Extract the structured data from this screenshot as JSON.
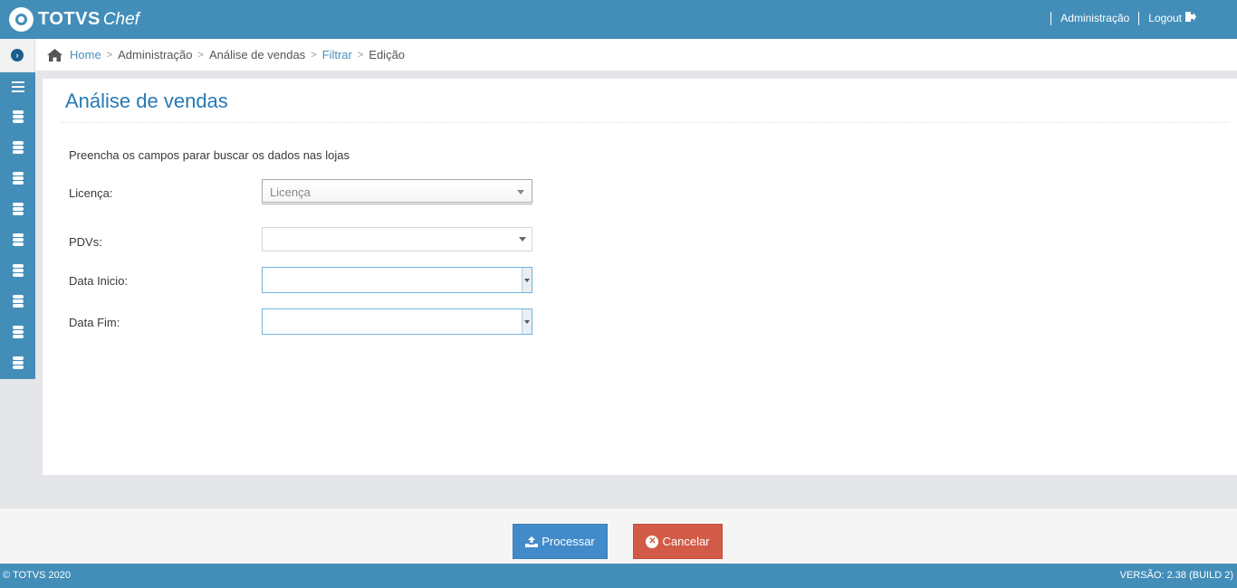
{
  "header": {
    "brand_totvs": "TOTVS",
    "brand_chef": "Chef",
    "admin_link": "Administração",
    "logout_link": "Logout"
  },
  "breadcrumb": {
    "home": "Home",
    "administracao": "Administração",
    "analise": "Análise de vendas",
    "filtrar": "Filtrar",
    "edicao": "Edição"
  },
  "page": {
    "title": "Análise de vendas",
    "instructions": "Preencha os campos parar buscar os dados nas lojas"
  },
  "form": {
    "licenca_label": "Licença:",
    "licenca_value": "Licença",
    "pdvs_label": "PDVs:",
    "pdvs_value": "",
    "data_inicio_label": "Data Inicio:",
    "data_inicio_value": "",
    "data_fim_label": "Data Fim:",
    "data_fim_value": ""
  },
  "actions": {
    "processar": "Processar",
    "cancelar": "Cancelar"
  },
  "footer": {
    "copyright": "© TOTVS 2020",
    "version": "VERSÃO: 2.38 (BUILD 2)"
  },
  "colors": {
    "brand": "#438eb9",
    "primary_button": "#428bca",
    "danger_button": "#d15b47",
    "title": "#2679b5"
  },
  "icons": {
    "sidebar_toggle": "chevron-right-circle-icon",
    "menu": "bars-icon",
    "sidebar_items": [
      "database-icon",
      "database-icon",
      "database-icon",
      "database-icon",
      "database-icon",
      "database-icon",
      "database-icon",
      "database-icon",
      "database-icon"
    ]
  }
}
